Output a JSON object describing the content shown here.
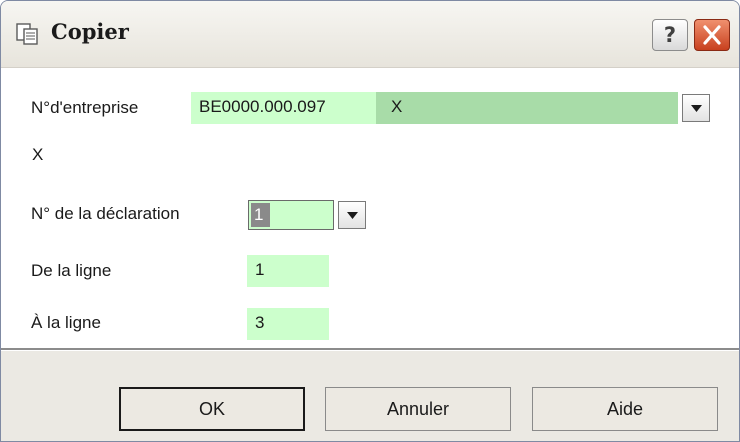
{
  "window": {
    "title": "Copier"
  },
  "titlebar": {
    "help_label": "?"
  },
  "form": {
    "enterprise": {
      "label": "N°d'entreprise",
      "value": "BE0000.000.097",
      "suffix": "X",
      "second_line": "X"
    },
    "declaration": {
      "label": "N° de la déclaration",
      "value": "1"
    },
    "from_line": {
      "label": "De la ligne",
      "value": "1"
    },
    "to_line": {
      "label": "À la ligne",
      "value": "3"
    }
  },
  "buttons": {
    "ok": "OK",
    "cancel": "Annuler",
    "help": "Aide"
  },
  "colors": {
    "field_bg": "#ccffcc",
    "field_selected_bg": "#a8dca8",
    "close_button": "#d8502e"
  },
  "icons": {
    "window": "copy-document-icon",
    "dropdown": "chevron-down-icon",
    "close": "close-icon"
  }
}
